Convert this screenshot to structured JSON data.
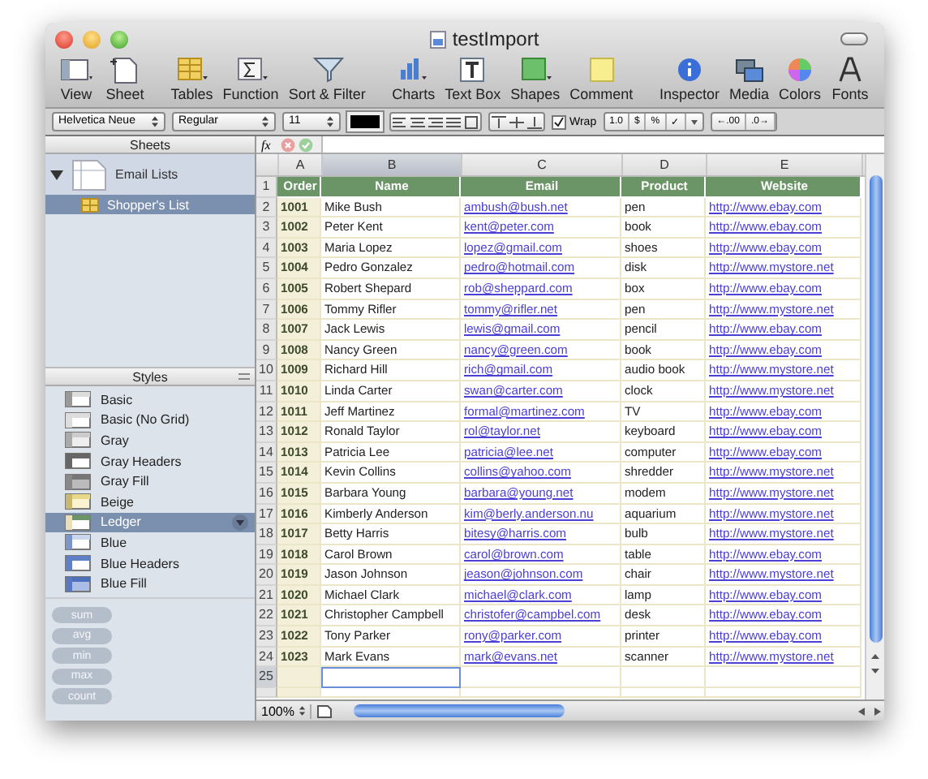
{
  "window": {
    "title": "testImport"
  },
  "toolbar": [
    [
      {
        "label": "View"
      },
      {
        "label": "Sheet"
      }
    ],
    [
      {
        "label": "Tables"
      },
      {
        "label": "Function"
      },
      {
        "label": "Sort & Filter"
      }
    ],
    [
      {
        "label": "Charts"
      },
      {
        "label": "Text Box"
      },
      {
        "label": "Shapes"
      },
      {
        "label": "Comment"
      }
    ],
    [
      {
        "label": "Inspector"
      },
      {
        "label": "Media"
      },
      {
        "label": "Colors"
      },
      {
        "label": "Fonts"
      }
    ]
  ],
  "format_bar": {
    "font": "Helvetica Neue",
    "style": "Regular",
    "size": "11",
    "wrap": {
      "label": "Wrap",
      "checked": true
    },
    "number_formats": [
      "1.0",
      "$",
      "%",
      "✓"
    ],
    "decimals": [
      "←.00",
      ".0→"
    ]
  },
  "sidebar": {
    "sheets_header": "Sheets",
    "sheets": [
      {
        "label": "Email Lists",
        "expanded": true,
        "selected": false,
        "children": [
          {
            "label": "Shopper's List",
            "selected": true
          }
        ]
      }
    ],
    "styles_header": "Styles",
    "styles": [
      {
        "label": "Basic",
        "selected": false
      },
      {
        "label": "Basic (No Grid)",
        "selected": false
      },
      {
        "label": "Gray",
        "selected": false
      },
      {
        "label": "Gray Headers",
        "selected": false
      },
      {
        "label": "Gray Fill",
        "selected": false
      },
      {
        "label": "Beige",
        "selected": false
      },
      {
        "label": "Ledger",
        "selected": true
      },
      {
        "label": "Blue",
        "selected": false
      },
      {
        "label": "Blue Headers",
        "selected": false
      },
      {
        "label": "Blue Fill",
        "selected": false
      }
    ],
    "functions": [
      {
        "label": "sum",
        "disabled": true
      },
      {
        "label": "avg",
        "disabled": true
      },
      {
        "label": "min",
        "disabled": true
      },
      {
        "label": "max",
        "disabled": true
      },
      {
        "label": "count",
        "disabled": true
      }
    ]
  },
  "formula_bar": {
    "label": "fx"
  },
  "table": {
    "columns": [
      {
        "letter": "A",
        "selected": false
      },
      {
        "letter": "B",
        "selected": true
      },
      {
        "letter": "C",
        "selected": false
      },
      {
        "letter": "D",
        "selected": false
      },
      {
        "letter": "E",
        "selected": false
      }
    ],
    "rows": [
      {
        "number": "1",
        "kind": "header",
        "selected": false,
        "cells": [
          "Order",
          "Name",
          "Email",
          "Product",
          "Website"
        ]
      },
      {
        "number": "2",
        "kind": "data",
        "selected": false,
        "cells": [
          "1001",
          "Mike Bush",
          "ambush@bush.net",
          "pen",
          "http://www.ebay.com"
        ]
      },
      {
        "number": "3",
        "kind": "data",
        "selected": false,
        "cells": [
          "1002",
          "Peter Kent",
          "kent@peter.com",
          "book",
          "http://www.ebay.com"
        ]
      },
      {
        "number": "4",
        "kind": "data",
        "selected": false,
        "cells": [
          "1003",
          "Maria Lopez",
          "lopez@gmail.com",
          "shoes",
          "http://www.ebay.com"
        ]
      },
      {
        "number": "5",
        "kind": "data",
        "selected": false,
        "cells": [
          "1004",
          "Pedro Gonzalez",
          "pedro@hotmail.com",
          "disk",
          "http://www.mystore.net"
        ]
      },
      {
        "number": "6",
        "kind": "data",
        "selected": false,
        "cells": [
          "1005",
          "Robert Shepard",
          "rob@sheppard.com",
          "box",
          "http://www.ebay.com"
        ]
      },
      {
        "number": "7",
        "kind": "data",
        "selected": false,
        "cells": [
          "1006",
          "Tommy Rifler",
          "tommy@rifler.net",
          "pen",
          "http://www.mystore.net"
        ]
      },
      {
        "number": "8",
        "kind": "data",
        "selected": false,
        "cells": [
          "1007",
          "Jack Lewis",
          "lewis@gmail.com",
          "pencil",
          "http://www.ebay.com"
        ]
      },
      {
        "number": "9",
        "kind": "data",
        "selected": false,
        "cells": [
          "1008",
          "Nancy Green",
          "nancy@green.com",
          "book",
          "http://www.ebay.com"
        ]
      },
      {
        "number": "10",
        "kind": "data",
        "selected": false,
        "cells": [
          "1009",
          "Richard Hill",
          "rich@gmail.com",
          "audio book",
          "http://www.mystore.net"
        ]
      },
      {
        "number": "11",
        "kind": "data",
        "selected": false,
        "cells": [
          "1010",
          "Linda Carter",
          "swan@carter.com",
          "clock",
          "http://www.mystore.net"
        ]
      },
      {
        "number": "12",
        "kind": "data",
        "selected": false,
        "cells": [
          "1011",
          "Jeff Martinez",
          "formal@martinez.com",
          "TV",
          "http://www.ebay.com"
        ]
      },
      {
        "number": "13",
        "kind": "data",
        "selected": false,
        "cells": [
          "1012",
          "Ronald Taylor",
          "rol@taylor.net",
          "keyboard",
          "http://www.ebay.com"
        ]
      },
      {
        "number": "14",
        "kind": "data",
        "selected": false,
        "cells": [
          "1013",
          "Patricia Lee",
          "patricia@lee.net",
          "computer",
          "http://www.ebay.com"
        ]
      },
      {
        "number": "15",
        "kind": "data",
        "selected": false,
        "cells": [
          "1014",
          "Kevin Collins",
          "collins@yahoo.com",
          "shredder",
          "http://www.mystore.net"
        ]
      },
      {
        "number": "16",
        "kind": "data",
        "selected": false,
        "cells": [
          "1015",
          "Barbara Young",
          "barbara@young.net",
          "modem",
          "http://www.mystore.net"
        ]
      },
      {
        "number": "17",
        "kind": "data",
        "selected": false,
        "cells": [
          "1016",
          "Kimberly Anderson",
          "kim@berly.anderson.nu",
          "aquarium",
          "http://www.mystore.net"
        ]
      },
      {
        "number": "18",
        "kind": "data",
        "selected": false,
        "cells": [
          "1017",
          "Betty Harris",
          "bitesy@harris.com",
          "bulb",
          "http://www.mystore.net"
        ]
      },
      {
        "number": "19",
        "kind": "data",
        "selected": false,
        "cells": [
          "1018",
          "Carol Brown",
          "carol@brown.com",
          "table",
          "http://www.ebay.com"
        ]
      },
      {
        "number": "20",
        "kind": "data",
        "selected": false,
        "cells": [
          "1019",
          "Jason Johnson",
          "jeason@johnson.com",
          "chair",
          "http://www.mystore.net"
        ]
      },
      {
        "number": "21",
        "kind": "data",
        "selected": false,
        "cells": [
          "1020",
          "Michael Clark",
          "michael@clark.com",
          "lamp",
          "http://www.ebay.com"
        ]
      },
      {
        "number": "22",
        "kind": "data",
        "selected": false,
        "cells": [
          "1021",
          "Christopher Campbell",
          "christofer@campbel.com",
          "desk",
          "http://www.ebay.com"
        ]
      },
      {
        "number": "23",
        "kind": "data",
        "selected": false,
        "cells": [
          "1022",
          "Tony Parker",
          "rony@parker.com",
          "printer",
          "http://www.ebay.com"
        ]
      },
      {
        "number": "24",
        "kind": "data",
        "selected": false,
        "cells": [
          "1023",
          "Mark Evans",
          "mark@evans.net",
          "scanner",
          "http://www.mystore.net"
        ]
      },
      {
        "number": "25",
        "kind": "empty",
        "selected": true
      }
    ]
  },
  "zoom": "100%"
}
